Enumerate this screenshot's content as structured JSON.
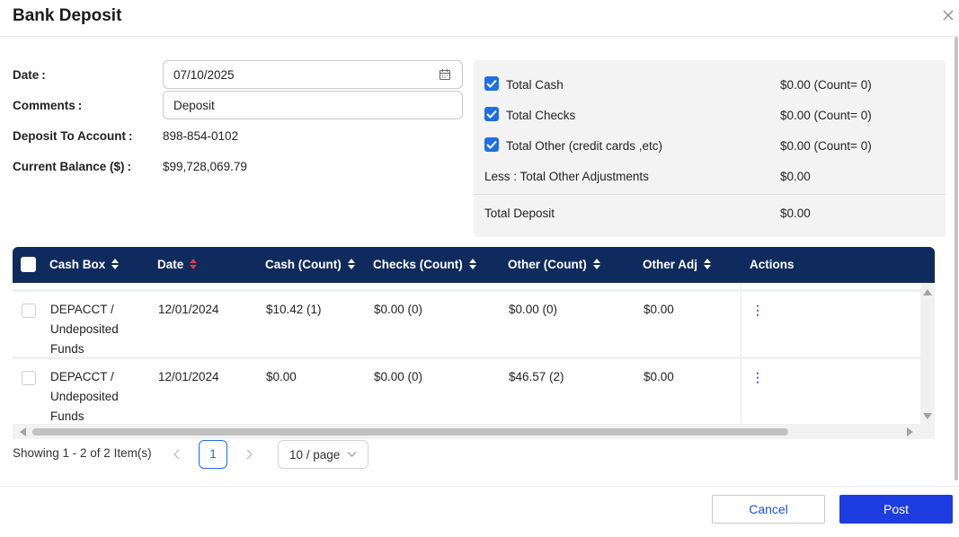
{
  "dialog": {
    "title": "Bank Deposit"
  },
  "form": {
    "date_label": "Date",
    "date_value": "07/10/2025",
    "comments_label": "Comments",
    "comments_value": "Deposit",
    "account_label": "Deposit To Account",
    "account_value": "898-854-0102",
    "balance_label": "Current Balance ($)",
    "balance_value": "$99,728,069.79",
    "colon": ":"
  },
  "summary": {
    "rows": [
      {
        "label": "Total Cash",
        "value": "$0.00 (Count= 0)",
        "checked": true
      },
      {
        "label": "Total Checks",
        "value": "$0.00 (Count= 0)",
        "checked": true
      },
      {
        "label": "Total Other (credit cards ,etc)",
        "value": "$0.00 (Count= 0)",
        "checked": true
      },
      {
        "label": "Less : Total Other Adjustments",
        "value": "$0.00"
      },
      {
        "label": "Total Deposit",
        "value": "$0.00"
      }
    ]
  },
  "table": {
    "columns": [
      "Cash Box",
      "Date",
      "Cash (Count)",
      "Checks (Count)",
      "Other (Count)",
      "Other Adj",
      "Actions"
    ],
    "sorted_column": "Date",
    "rows": [
      {
        "cash_box": [
          "DEPACCT /",
          "Undeposited",
          "Funds"
        ],
        "date": "12/01/2024",
        "cash": "$10.42 (1)",
        "checks": "$0.00 (0)",
        "other": "$0.00 (0)",
        "other_adj": "$0.00",
        "action": "⋮"
      },
      {
        "cash_box": [
          "DEPACCT /",
          "Undeposited",
          "Funds"
        ],
        "date": "12/01/2024",
        "cash": "$0.00",
        "checks": "$0.00 (0)",
        "other": "$46.57 (2)",
        "other_adj": "$0.00",
        "action": "⋮"
      }
    ]
  },
  "pagination": {
    "showing": "Showing 1 - 2 of 2 Item(s)",
    "current_page": "1",
    "page_size": "10 / page"
  },
  "footer": {
    "cancel_label": "Cancel",
    "post_label": "Post"
  },
  "colors": {
    "header_bg": "#0f2a5c",
    "accent": "#1d6fe8",
    "primary_button": "#1d3de0",
    "sort_active": "#e53935"
  }
}
